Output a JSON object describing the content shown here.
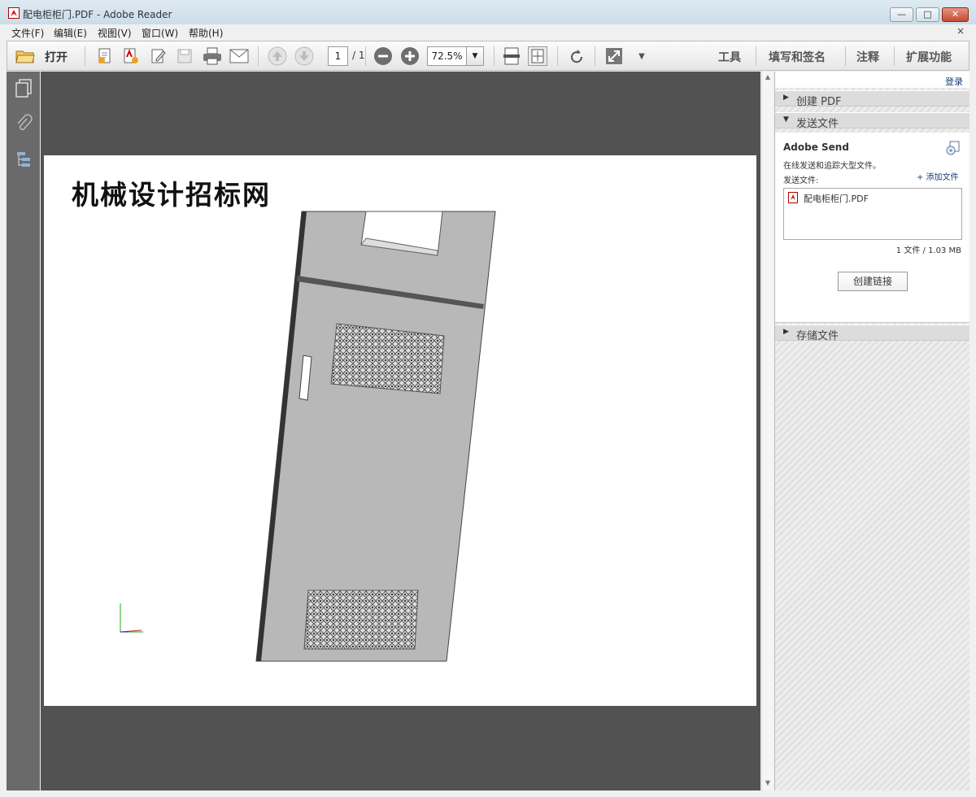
{
  "window": {
    "title": "配电柜柜门.PDF - Adobe Reader",
    "minimize": "—",
    "maximize": "□",
    "close": "✕"
  },
  "menu": {
    "items": [
      "文件(F)",
      "编辑(E)",
      "视图(V)",
      "窗口(W)",
      "帮助(H)"
    ],
    "close_doc": "×"
  },
  "toolbar": {
    "open_label": "打开",
    "page_current": "1",
    "page_total": "/ 1",
    "zoom": "72.5%",
    "icons": [
      "open-folder-icon",
      "create-pdf-icon",
      "export-pdf-icon",
      "edit-pdf-icon",
      "save-icon",
      "print-icon",
      "email-icon",
      "previous-page-icon",
      "next-page-icon",
      "zoom-out-icon",
      "zoom-in-icon",
      "fit-width-icon",
      "fit-page-icon",
      "rotate-icon",
      "full-screen-icon"
    ],
    "right_tabs": [
      "工具",
      "填写和签名",
      "注释",
      "扩展功能"
    ]
  },
  "document": {
    "heading": "机械设计招标网"
  },
  "right_panel": {
    "login": "登录",
    "sections": {
      "create_pdf": "创建 PDF",
      "send_files": "发送文件",
      "store_files": "存储文件"
    },
    "send": {
      "title": "Adobe Send",
      "description": "在线发送和追踪大型文件。",
      "files_label": "发送文件:",
      "add_file": "+ 添加文件",
      "file_name": "配电柜柜门.PDF",
      "summary": "1 文件 / 1.03 MB",
      "create_link": "创建链接"
    }
  },
  "colors": {
    "doc_background": "#525252",
    "nav_background": "#6a6a6a",
    "link": "#123c75"
  }
}
